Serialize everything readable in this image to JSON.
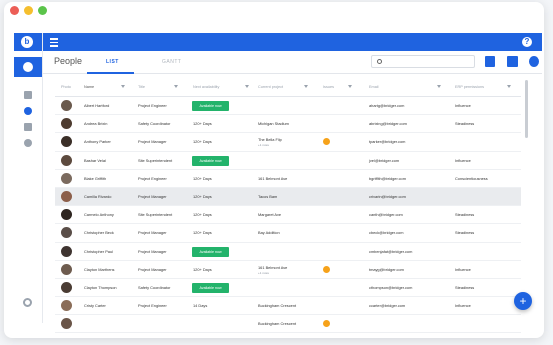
{
  "window_controls": {
    "colors": [
      "#ec5e57",
      "#f5bf2e",
      "#5bc44a"
    ]
  },
  "app": {
    "logo_letter": "b",
    "help_label": "?"
  },
  "header": {
    "title": "People",
    "tabs": [
      "LIST",
      "GANTT"
    ],
    "active_tab": "LIST"
  },
  "fab_label": "+",
  "table": {
    "columns": [
      "Photo",
      "Name",
      "Title",
      "Next availability",
      "Current project",
      "Issues",
      "Email",
      "ERP permissions"
    ],
    "rows": [
      {
        "name": "Albert Hartford",
        "title": "Project Engineer",
        "availability": "Available now",
        "available_pill": true,
        "project": "",
        "project_sub": "",
        "issue": false,
        "email": "ahartg@bridger.com",
        "permission": "Influence",
        "avatar": "#6a5a4d"
      },
      {
        "name": "Andrea Brixin",
        "title": "Safety Coordinator",
        "availability": "120+ Days",
        "available_pill": false,
        "project": "Michigan Stadium",
        "project_sub": "",
        "issue": false,
        "email": "abrixing@bridger.com",
        "permission": "Steadiness",
        "avatar": "#4e3c30"
      },
      {
        "name": "Anthony Parker",
        "title": "Project Manager",
        "availability": "120+ Days",
        "available_pill": false,
        "project": "The Bella Flip",
        "project_sub": "+1 more",
        "issue": true,
        "email": "tparker@bridger.com",
        "permission": "",
        "avatar": "#3b2f28"
      },
      {
        "name": "Bashar Velal",
        "title": "Site Superintendent",
        "availability": "Available now",
        "available_pill": true,
        "project": "",
        "project_sub": "",
        "issue": false,
        "email": "jvel@bridger.com",
        "permission": "Influence",
        "avatar": "#5d4a3e"
      },
      {
        "name": "Blake Griffith",
        "title": "Project Engineer",
        "availability": "120+ Days",
        "available_pill": false,
        "project": "161 Belmont Ave",
        "project_sub": "",
        "issue": false,
        "email": "bgriffith@bridger.com",
        "permission": "Conscientiousness",
        "avatar": "#7b6a5e"
      },
      {
        "name": "Camilla Rivardo",
        "title": "Project Manager",
        "availability": "120+ Days",
        "available_pill": false,
        "project": "Tacos Bam",
        "project_sub": "",
        "issue": false,
        "email": "crivarin@bridger.com",
        "permission": "",
        "avatar": "#8c5f4a",
        "selected": true
      },
      {
        "name": "Carmelo Anthony",
        "title": "Site Superintendent",
        "availability": "120+ Days",
        "available_pill": false,
        "project": "Margaret Ave",
        "project_sub": "",
        "issue": false,
        "email": "canth@bridger.com",
        "permission": "Steadiness",
        "avatar": "#2e2520"
      },
      {
        "name": "Christopher Beck",
        "title": "Project Manager",
        "availability": "120+ Days",
        "available_pill": false,
        "project": "Bay Addition",
        "project_sub": "",
        "issue": false,
        "email": "cbeck@bridger.com",
        "permission": "Steadiness",
        "avatar": "#5a4e48"
      },
      {
        "name": "Christopher Paul",
        "title": "Project Manager",
        "availability": "Available now",
        "available_pill": true,
        "project": "",
        "project_sub": "",
        "issue": false,
        "email": "cmbenjafat@bridger.com",
        "permission": "",
        "avatar": "#3f3430"
      },
      {
        "name": "Clayton Marthens",
        "title": "Project Manager",
        "availability": "120+ Days",
        "available_pill": false,
        "project": "161 Belmont Ave",
        "project_sub": "+1 more",
        "issue": true,
        "email": "tmayg@bridger.com",
        "permission": "Influence",
        "avatar": "#6e5c4f"
      },
      {
        "name": "Clayton Thompson",
        "title": "Safety Coordinator",
        "availability": "Available now",
        "available_pill": true,
        "project": "",
        "project_sub": "",
        "issue": false,
        "email": "cthompson@bridger.com",
        "permission": "Steadiness",
        "avatar": "#4a3c33"
      },
      {
        "name": "Cristy Carter",
        "title": "Project Engineer",
        "availability": "14 Days",
        "available_pill": false,
        "project": "Buckingham Crescent",
        "project_sub": "",
        "issue": false,
        "email": "ccarter@bridger.com",
        "permission": "Influence",
        "avatar": "#8a6d58"
      },
      {
        "name": "",
        "title": "",
        "availability": "",
        "available_pill": false,
        "project": "Buckingham Crescent",
        "project_sub": "",
        "issue": true,
        "email": "",
        "permission": "",
        "avatar": "#6a5548"
      }
    ]
  }
}
